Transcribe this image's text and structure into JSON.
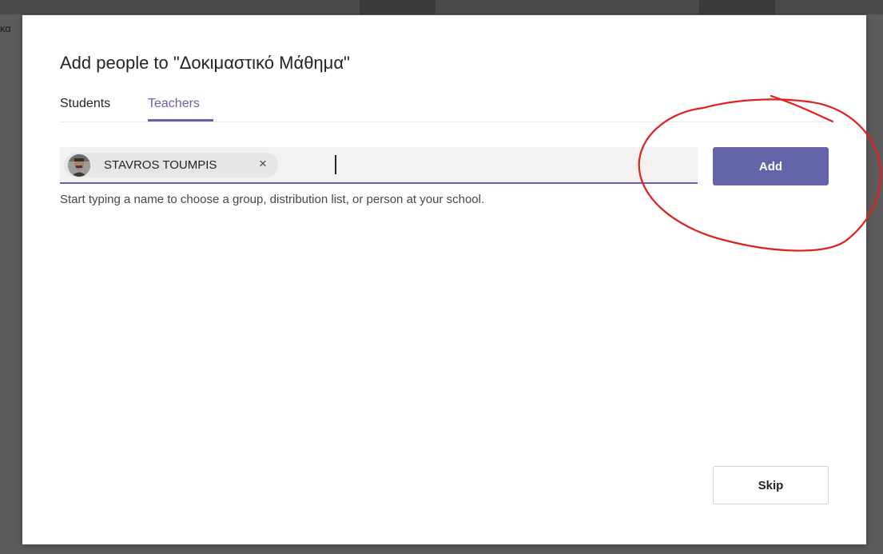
{
  "backdrop": {
    "partial_text": "κα"
  },
  "dialog": {
    "title": "Add people to \"Δοκιμαστικό Μάθημα\"",
    "tabs": [
      {
        "label": "Students",
        "active": false
      },
      {
        "label": "Teachers",
        "active": true
      }
    ],
    "picker": {
      "selected_people": [
        {
          "name": "STAVROS TOUMPIS",
          "remove_glyph": "×",
          "avatar": "avatar-photo"
        }
      ],
      "value": ""
    },
    "helper_text": "Start typing a name to choose a group, distribution list, or person at your school.",
    "add_label": "Add",
    "skip_label": "Skip"
  },
  "colors": {
    "accent": "#6264a7",
    "annotation": "#e0201a",
    "overlay": "#5c5c5c"
  }
}
